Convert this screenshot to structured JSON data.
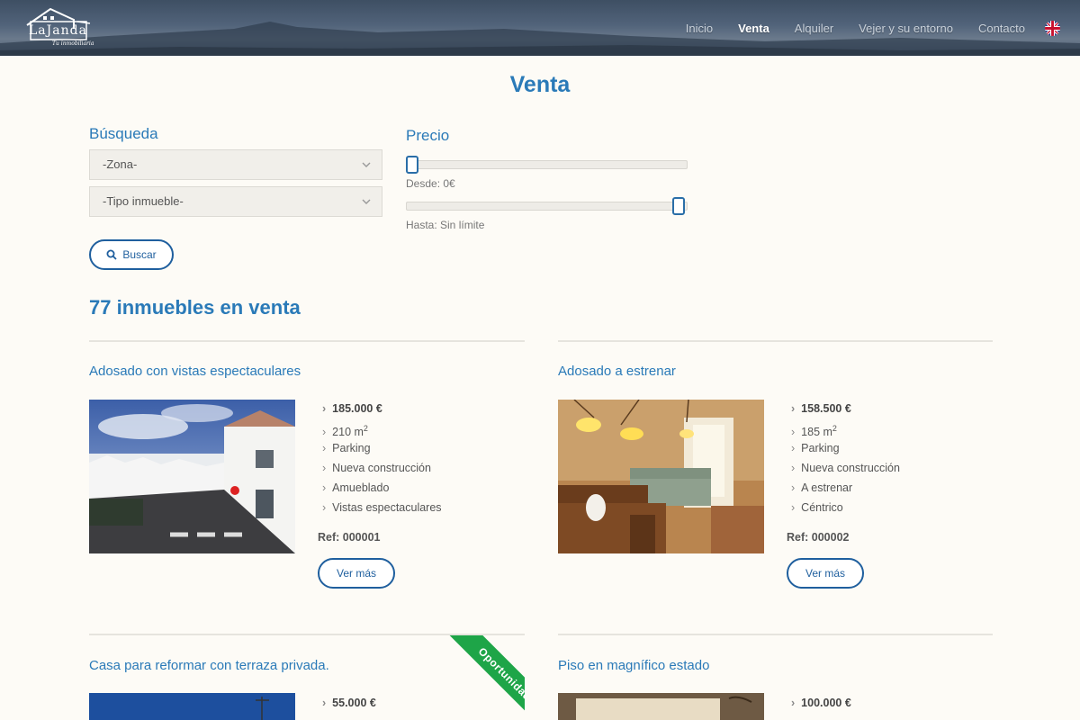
{
  "brand": {
    "logo_text": "LaJanda",
    "logo_sub": "Tu inmobiliaria"
  },
  "nav": [
    {
      "label": "Inicio",
      "active": false
    },
    {
      "label": "Venta",
      "active": true
    },
    {
      "label": "Alquiler",
      "active": false
    },
    {
      "label": "Vejer y su entorno",
      "active": false
    },
    {
      "label": "Contacto",
      "active": false
    }
  ],
  "page_title": "Venta",
  "search": {
    "label": "Búsqueda",
    "zona_value": "-Zona-",
    "tipo_value": "-Tipo inmueble-",
    "button_label": "Buscar",
    "icon": "search-icon"
  },
  "price": {
    "label": "Precio",
    "desde_label": "Desde: 0€",
    "hasta_label": "Hasta: Sin límite",
    "desde_fraction": 0,
    "hasta_fraction": 1
  },
  "results_title": "77 inmuebles en venta",
  "listings": [
    {
      "title": "Adosado con vistas espectaculares",
      "price": "185.000 €",
      "area": "210 m",
      "area_sup": "2",
      "features": [
        "Parking",
        "Nueva construcción",
        "Amueblado",
        "Vistas espectaculares"
      ],
      "ref": "Ref: 000001",
      "button": "Ver más"
    },
    {
      "title": "Adosado a estrenar",
      "price": "158.500 €",
      "area": "185 m",
      "area_sup": "2",
      "features": [
        "Parking",
        "Nueva construcción",
        "A estrenar",
        "Céntrico"
      ],
      "ref": "Ref: 000002",
      "button": "Ver más"
    },
    {
      "title": "Casa para reformar con terraza privada.",
      "price": "55.000 €",
      "ribbon": "Oportunidad"
    },
    {
      "title": "Piso en magnífico estado",
      "price": "100.000 €"
    }
  ],
  "colors": {
    "accent": "#2a7ab8",
    "button_border": "#1f5f9e",
    "ribbon": "#1ea548",
    "background": "#fdfbf6"
  }
}
